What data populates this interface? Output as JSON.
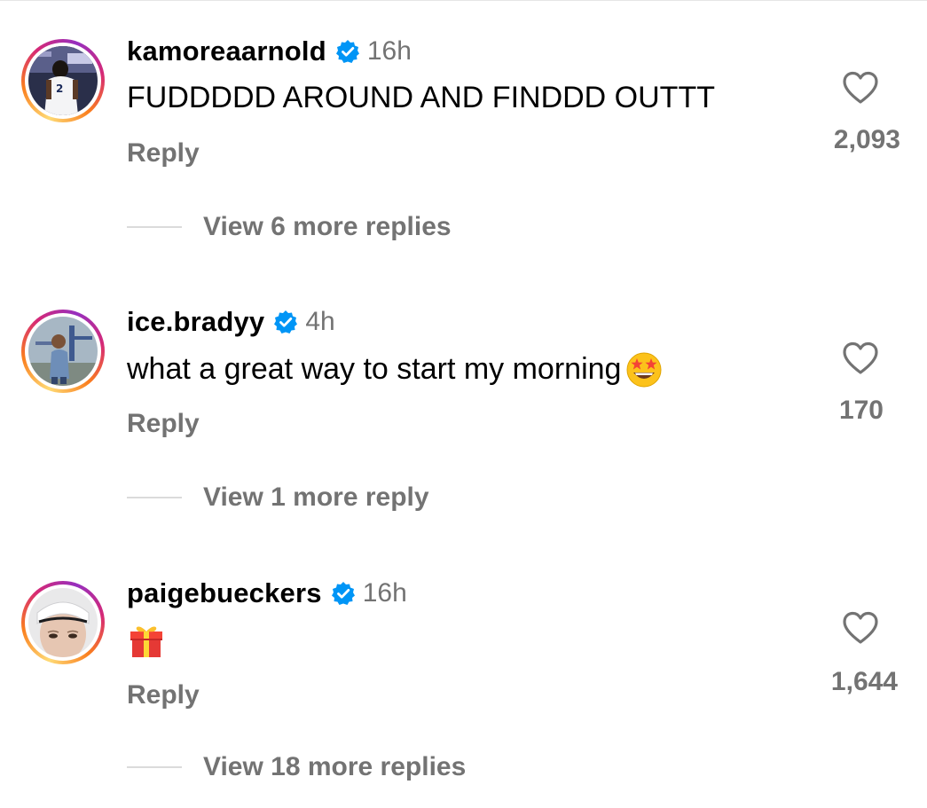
{
  "comments": [
    {
      "username": "kamoreaarnold",
      "time": "16h",
      "text": "FUDDDDD AROUND AND FINDDD OUTTT",
      "emoji": "",
      "reply_label": "Reply",
      "view_replies": "View 6 more replies",
      "likes": "2,093"
    },
    {
      "username": "ice.bradyy",
      "time": "4h",
      "text": "what a great way to start my morning",
      "emoji": "star-struck-emoji",
      "reply_label": "Reply",
      "view_replies": "View 1 more reply",
      "likes": "170"
    },
    {
      "username": "paigebueckers",
      "time": "16h",
      "text": "",
      "emoji": "gift-emoji",
      "reply_label": "Reply",
      "view_replies": "View 18 more replies",
      "likes": "1,644"
    }
  ],
  "colors": {
    "verified_blue": "#0095f6",
    "secondary_text": "#737373",
    "primary_text": "#000000"
  },
  "icons": {
    "verified": "verified-badge-icon",
    "like": "heart-outline-icon"
  }
}
